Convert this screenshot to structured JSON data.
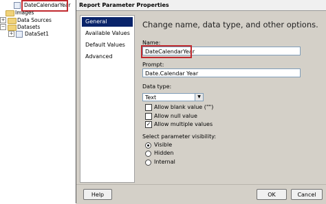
{
  "tree": {
    "items": [
      {
        "label": "DateCalendarYear",
        "selected": true
      },
      {
        "label": "Images"
      },
      {
        "label": "Data Sources"
      },
      {
        "label": "Datasets"
      },
      {
        "label": "DataSet1"
      }
    ]
  },
  "dialog": {
    "title": "Report Parameter Properties",
    "nav": [
      "General",
      "Available Values",
      "Default Values",
      "Advanced"
    ],
    "heading": "Change name, data type, and other options.",
    "name_label": "Name:",
    "name_value": "DateCalendarYear",
    "prompt_label": "Prompt:",
    "prompt_value": "Date.Calendar Year",
    "datatype_label": "Data type:",
    "datatype_value": "Text",
    "checks": [
      {
        "label": "Allow blank value (\"\")",
        "checked": false
      },
      {
        "label": "Allow null value",
        "checked": false
      },
      {
        "label": "Allow multiple values",
        "checked": true
      }
    ],
    "visibility_label": "Select parameter visibility:",
    "radios": [
      {
        "label": "Visible",
        "selected": true
      },
      {
        "label": "Hidden",
        "selected": false
      },
      {
        "label": "Internal",
        "selected": false
      }
    ],
    "help_button": "Help",
    "ok_button": "OK",
    "cancel_button": "Cancel"
  },
  "colors": {
    "highlight": "#c0282d",
    "nav_selected": "#0a246a"
  }
}
